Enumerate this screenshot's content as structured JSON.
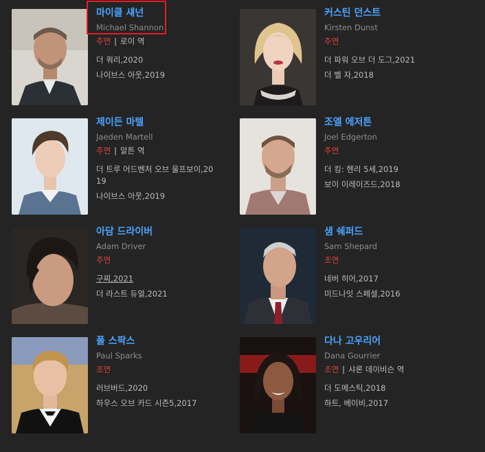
{
  "cast": [
    {
      "ko_name": "마이클 섀넌",
      "en_name": "Michael Shannon",
      "role_type": "주연",
      "separator": "|",
      "character": "로이 역",
      "films": [
        "더 쿼리,2020",
        "나이브스 아웃,2019"
      ]
    },
    {
      "ko_name": "커스틴 던스트",
      "en_name": "Kirsten Dunst",
      "role_type": "주연",
      "character": "",
      "films": [
        "더 파워 오브 더 도그,2021",
        "더 벨 자,2018"
      ]
    },
    {
      "ko_name": "제이든 마텔",
      "en_name": "Jaeden Martell",
      "role_type": "주연",
      "separator": "|",
      "character": "알튼 역",
      "films": [
        "더 트루 어드벤처 오브 울프보이,2019",
        "나이브스 아웃,2019"
      ]
    },
    {
      "ko_name": "조엘 에저튼",
      "en_name": "Joel Edgerton",
      "role_type": "주연",
      "character": "",
      "films": [
        "더 킹: 헨리 5세,2019",
        "보이 이레이즈드,2018"
      ]
    },
    {
      "ko_name": "아담 드라이버",
      "en_name": "Adam Driver",
      "role_type": "주연",
      "character": "",
      "films": [
        "구찌,2021",
        "더 라스트 듀얼,2021"
      ]
    },
    {
      "ko_name": "샘 쉐퍼드",
      "en_name": "Sam Shepard",
      "role_type": "조연",
      "character": "",
      "films": [
        "네버 히어,2017",
        "미드나잇 스페셜,2016"
      ]
    },
    {
      "ko_name": "폴 스팍스",
      "en_name": "Paul Sparks",
      "role_type": "조연",
      "character": "",
      "films": [
        "러브버드,2020",
        "하우스 오브 카드 시즌5,2017"
      ]
    },
    {
      "ko_name": "다나 고우리어",
      "en_name": "Dana Gourrier",
      "role_type": "조연",
      "separator": "|",
      "character": "샤론 데이비슨 역",
      "films": [
        "더 도메스틱,2018",
        "하트, 베이비,2017"
      ]
    }
  ],
  "colors": {
    "background": "#242424",
    "name_link": "#4aa3ff",
    "role_type": "#e0453b",
    "highlight_box": "#e51c23"
  }
}
